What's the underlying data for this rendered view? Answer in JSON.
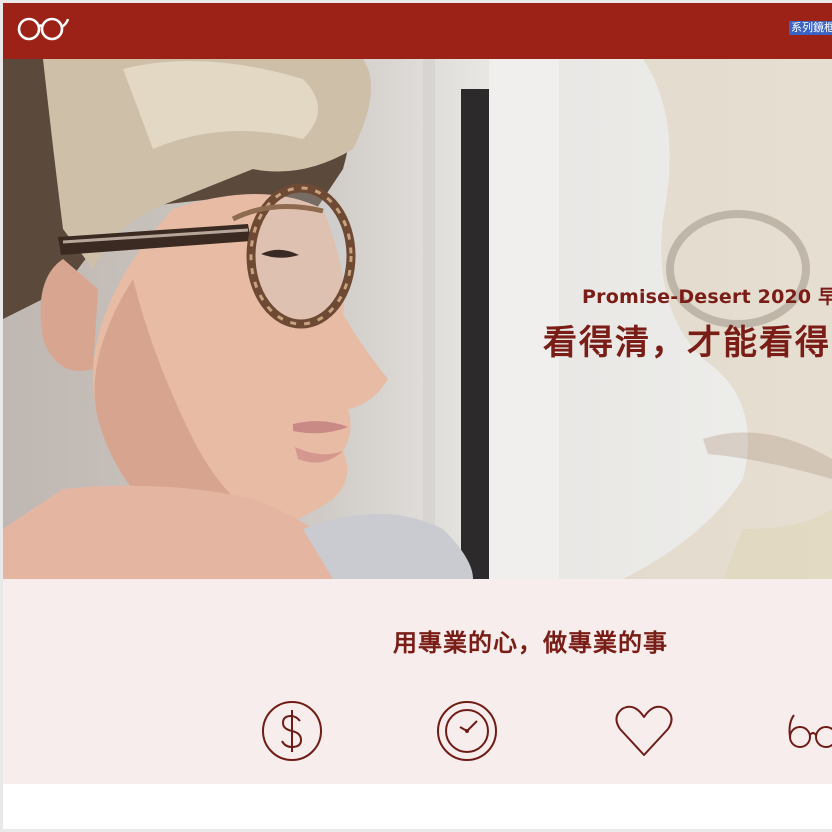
{
  "header": {
    "logo_icon": "eyeglasses-logo-icon",
    "nav_link": "系列鏡框",
    "background_color": "#9c2218"
  },
  "hero": {
    "subtitle": "Promise-Desert 2020 早",
    "title": "看得清，才能看得",
    "text_color": "#7a1d16"
  },
  "services": {
    "heading": "用專業的心，做專業的事",
    "icons": [
      "dollar-icon",
      "clock-icon",
      "heart-icon",
      "glasses-icon"
    ],
    "background_color": "#f8eded"
  }
}
